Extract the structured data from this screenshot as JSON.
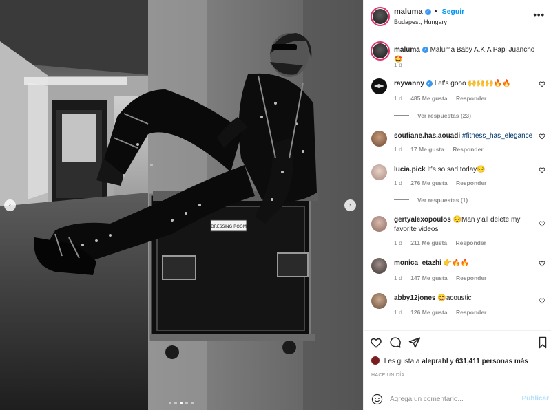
{
  "post": {
    "username": "maluma",
    "follow_label": "Seguir",
    "dot": "•",
    "location": "Budapest, Hungary",
    "more_label": "•••"
  },
  "caption": {
    "username": "maluma",
    "text": "Maluma Baby A.K.A Papi Juancho 🤩",
    "time": "1 d"
  },
  "photo": {
    "sign_text": "DRESSING ROOM",
    "prev_label": "‹",
    "next_label": "›",
    "dots_total": 5,
    "dots_active": 3
  },
  "comments": [
    {
      "username": "rayvanny",
      "verified": true,
      "text": "Let's gooo 🙌🙌🙌🔥🔥",
      "time": "1 d",
      "likes": "485 Me gusta",
      "reply": "Responder",
      "view_replies": "Ver respuestas (23)"
    },
    {
      "username": "soufiane.has.aouadi",
      "verified": false,
      "hashtag": "#fitness_has_elegance",
      "time": "1 d",
      "likes": "17 Me gusta",
      "reply": "Responder"
    },
    {
      "username": "lucia.pick",
      "verified": false,
      "text": "It's so sad today😔",
      "time": "1 d",
      "likes": "276 Me gusta",
      "reply": "Responder",
      "view_replies": "Ver respuestas (1)"
    },
    {
      "username": "gertyalexopoulos",
      "verified": false,
      "text": "😔Man y'all delete my favorite videos",
      "time": "1 d",
      "likes": "211 Me gusta",
      "reply": "Responder"
    },
    {
      "username": "monica_etazhi",
      "verified": false,
      "text": "👉🔥🔥",
      "time": "1 d",
      "likes": "147 Me gusta",
      "reply": "Responder"
    },
    {
      "username": "abby12jones",
      "verified": false,
      "text": "😄acoustic",
      "time": "1 d",
      "likes": "126 Me gusta",
      "reply": "Responder"
    }
  ],
  "likes_summary": {
    "prefix": "Les gusta a",
    "user": "aleprahl",
    "connector": "y",
    "count": "631,411 personas más"
  },
  "time_ago": "HACE UN DÍA",
  "composer": {
    "placeholder": "Agrega un comentario...",
    "publish_label": "Publicar"
  },
  "colors": {
    "accent": "#0095f6",
    "verified": "#3897f0",
    "story_ring": "#e1306c",
    "publish_disabled": "#b2dffc"
  }
}
